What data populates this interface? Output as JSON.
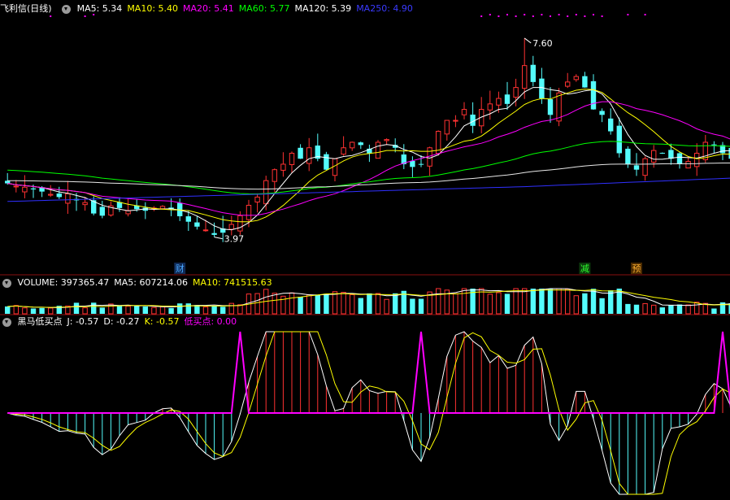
{
  "stock": {
    "name": "飞利信",
    "period": "(日线)"
  },
  "price_legend": [
    {
      "label": "MA5: 5.34",
      "color": "#ffffff"
    },
    {
      "label": "MA10: 5.40",
      "color": "#ffff00"
    },
    {
      "label": "MA20: 5.41",
      "color": "#ff00ff"
    },
    {
      "label": "MA60: 5.77",
      "color": "#00ff00"
    },
    {
      "label": "MA120: 5.39",
      "color": "#ffffff"
    },
    {
      "label": "MA250: 4.90",
      "color": "#3a3aff"
    }
  ],
  "volume_legend": [
    {
      "label": "VOLUME: 397365.47",
      "color": "#ffffff"
    },
    {
      "label": "MA5: 607214.06",
      "color": "#ffffff"
    },
    {
      "label": "MA10: 741515.63",
      "color": "#ffff00"
    }
  ],
  "ind_legend": [
    {
      "label": "黑马低买点",
      "color": "#ffffff"
    },
    {
      "label": "J: -0.57",
      "color": "#ffffff"
    },
    {
      "label": "D: -0.27",
      "color": "#ffffff"
    },
    {
      "label": "K: -0.57",
      "color": "#ffff00"
    },
    {
      "label": "低买点: 0.00",
      "color": "#ff00ff"
    }
  ],
  "markers": [
    {
      "text": "财",
      "color": "#4aa8ff",
      "bg": "#102a55",
      "day": 20
    },
    {
      "text": "减",
      "color": "#2eff2e",
      "bg": "#0c3a0c",
      "day": 67
    },
    {
      "text": "预",
      "color": "#ffb030",
      "bg": "#4a2a00",
      "day": 73
    }
  ],
  "chart_data": {
    "type": "candlestick",
    "price_ylim": [
      3.4,
      8.0
    ],
    "high_label": "7.60",
    "low_label": "3.97",
    "high_day": 60,
    "low_day": 24,
    "closes": [
      4.95,
      4.9,
      4.88,
      4.84,
      4.8,
      4.75,
      4.7,
      4.76,
      4.64,
      4.6,
      4.4,
      4.36,
      4.54,
      4.5,
      4.45,
      4.48,
      4.45,
      4.5,
      4.53,
      4.48,
      4.35,
      4.25,
      4.16,
      4.1,
      4.01,
      4.05,
      4.2,
      4.36,
      4.55,
      4.7,
      5.0,
      5.2,
      5.3,
      5.5,
      5.4,
      5.6,
      5.4,
      5.2,
      5.4,
      5.6,
      5.7,
      5.65,
      5.5,
      5.7,
      5.75,
      5.6,
      5.3,
      5.25,
      5.3,
      5.6,
      5.9,
      6.1,
      6.1,
      6.3,
      6.0,
      6.3,
      6.4,
      6.5,
      6.4,
      6.7,
      7.1,
      6.8,
      6.5,
      6.2,
      6.6,
      6.8,
      6.9,
      6.7,
      6.3,
      6.2,
      5.9,
      5.5,
      5.3,
      5.2,
      5.4,
      5.55,
      5.5,
      5.4,
      5.3,
      5.35,
      5.5,
      5.7,
      5.65,
      5.5,
      5.4
    ]
  }
}
